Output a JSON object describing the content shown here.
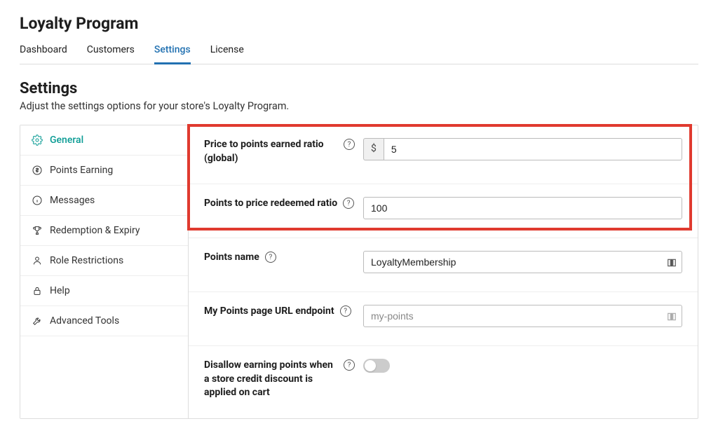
{
  "header": {
    "title": "Loyalty Program"
  },
  "tabs": {
    "dashboard": "Dashboard",
    "customers": "Customers",
    "settings": "Settings",
    "license": "License"
  },
  "section": {
    "title": "Settings",
    "description": "Adjust the settings options for your store's Loyalty Program."
  },
  "sidebar": {
    "general": "General",
    "points_earning": "Points Earning",
    "messages": "Messages",
    "redemption": "Redemption & Expiry",
    "role": "Role Restrictions",
    "help": "Help",
    "advanced": "Advanced Tools"
  },
  "fields": {
    "price_to_points": {
      "label": "Price to points earned ratio (global)",
      "prefix": "$",
      "value": "5"
    },
    "points_to_price": {
      "label": "Points to price redeemed ratio",
      "value": "100"
    },
    "points_name": {
      "label": "Points name",
      "value": "LoyaltyMembership"
    },
    "url_endpoint": {
      "label": "My Points page URL endpoint",
      "placeholder": "my-points",
      "value": ""
    },
    "disallow": {
      "label": "Disallow earning points when a store credit discount is applied on cart"
    }
  }
}
